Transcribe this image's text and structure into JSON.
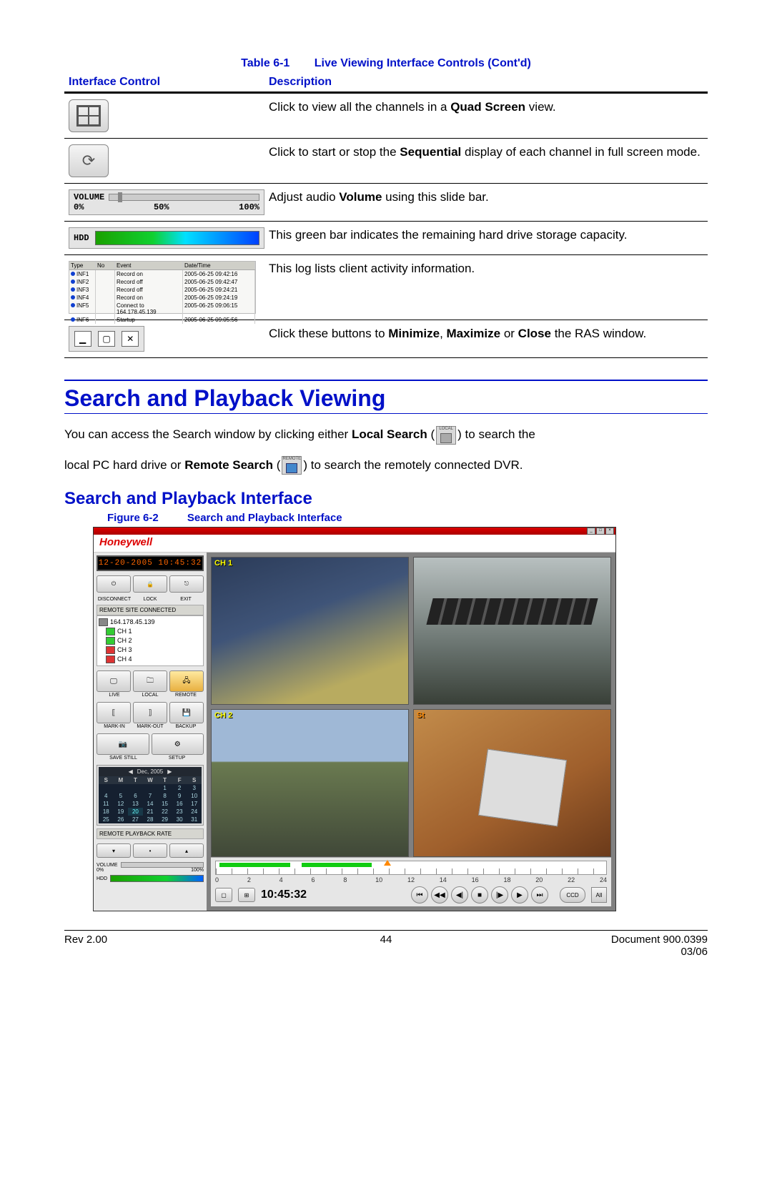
{
  "table": {
    "caption_label": "Table 6-1",
    "caption_title": "Live Viewing Interface Controls  (Cont'd)",
    "header_left": "Interface Control",
    "header_right": "Description",
    "rows": {
      "quad": {
        "text_a": "Click to view all the channels in a ",
        "bold_a": "Quad Screen",
        "text_b": " view."
      },
      "seq": {
        "text_a": "Click to start or stop the ",
        "bold_a": "Sequential",
        "text_b": " display of each channel in full screen mode."
      },
      "vol": {
        "text_a": "Adjust audio ",
        "bold_a": "Volume",
        "text_b": " using this slide bar.",
        "label": "VOLUME",
        "p0": "0%",
        "p50": "50%",
        "p100": "100%"
      },
      "hdd": {
        "label": "HDD",
        "text": "This green bar indicates the remaining hard drive storage capacity."
      },
      "log": {
        "text": "This log lists client activity information.",
        "hdr": {
          "c1": "Type",
          "c2": "No",
          "c3": "Event",
          "c4": "Date/Time"
        },
        "rows": [
          {
            "c1": "INF1",
            "c3": "Record on",
            "c4": "2005-06-25 09:42:16"
          },
          {
            "c1": "INF2",
            "c3": "Record off",
            "c4": "2005-06-25 09:42:47"
          },
          {
            "c1": "INF3",
            "c3": "Record off",
            "c4": "2005-06-25 09:24:21"
          },
          {
            "c1": "INF4",
            "c3": "Record on",
            "c4": "2005-06-25 09:24:19"
          },
          {
            "c1": "INF5",
            "c3": "Connect to 164.178.45.139",
            "c4": "2005-06-25 09:06:15"
          },
          {
            "c1": "INF6",
            "c3": "Startup",
            "c4": "2005-06-25 09:05:56"
          }
        ]
      },
      "win": {
        "text_a": "Click these buttons to ",
        "b1": "Minimize",
        "sep1": ", ",
        "b2": "Maximize",
        "sep2": " or ",
        "b3": "Close",
        "text_b": " the RAS window."
      }
    }
  },
  "heading1": "Search and Playback Viewing",
  "para": {
    "p1a": "You can access the Search window by clicking either ",
    "b1": "Local Search",
    "p1b": " (",
    "p1c": ") to search the",
    "p2a": "local PC hard drive or ",
    "b2": "Remote Search",
    "p2b": " (",
    "p2c": ") to search the remotely connected DVR.",
    "local_lbl": "LOCAL",
    "remote_lbl": "REMOTE"
  },
  "heading2": "Search and Playback Interface",
  "figure": {
    "label": "Figure 6-2",
    "title": "Search and Playback Interface"
  },
  "app": {
    "brand": "Honeywell",
    "lcd": "12-20-2005  10:45:32",
    "top_labels": {
      "a": "DISCONNECT",
      "b": "LOCK",
      "c": "EXIT"
    },
    "tree_header": "REMOTE SITE CONNECTED",
    "tree": {
      "ip": "164.178.45.139",
      "ch1": "CH 1",
      "ch2": "CH 2",
      "ch3": "CH 3",
      "ch4": "CH 4"
    },
    "mode_labels": {
      "a": "LIVE",
      "b": "LOCAL",
      "c": "REMOTE"
    },
    "mark_labels": {
      "a": "MARK-IN",
      "b": "MARK-OUT",
      "c": "BACKUP"
    },
    "save_labels": {
      "a": "SAVE STILL",
      "b": "SETUP"
    },
    "cal": {
      "month": "Dec, 2005",
      "dow": [
        "S",
        "M",
        "T",
        "W",
        "T",
        "F",
        "S"
      ],
      "weeks": [
        [
          "",
          "",
          "",
          "",
          "1",
          "2",
          "3"
        ],
        [
          "4",
          "5",
          "6",
          "7",
          "8",
          "9",
          "10"
        ],
        [
          "11",
          "12",
          "13",
          "14",
          "15",
          "16",
          "17"
        ],
        [
          "18",
          "19",
          "20",
          "21",
          "22",
          "23",
          "24"
        ],
        [
          "25",
          "26",
          "27",
          "28",
          "29",
          "30",
          "31"
        ]
      ],
      "hl_day": "20"
    },
    "rate_header": "REMOTE PLAYBACK RATE",
    "vol_label": "VOLUME",
    "vol_0": "0%",
    "vol_100": "100%",
    "hdd_label": "HDD",
    "cams": {
      "c1": "CH 1",
      "c2": "",
      "c3": "CH 2",
      "c4": "St"
    },
    "hours": [
      "0",
      "2",
      "4",
      "6",
      "8",
      "10",
      "12",
      "14",
      "16",
      "18",
      "20",
      "22",
      "24"
    ],
    "timecode": "10:45:32",
    "ccd": "CCD",
    "all": "All"
  },
  "footer": {
    "rev": "Rev 2.00",
    "page": "44",
    "doc": "Document 900.0399",
    "date": "03/06"
  }
}
